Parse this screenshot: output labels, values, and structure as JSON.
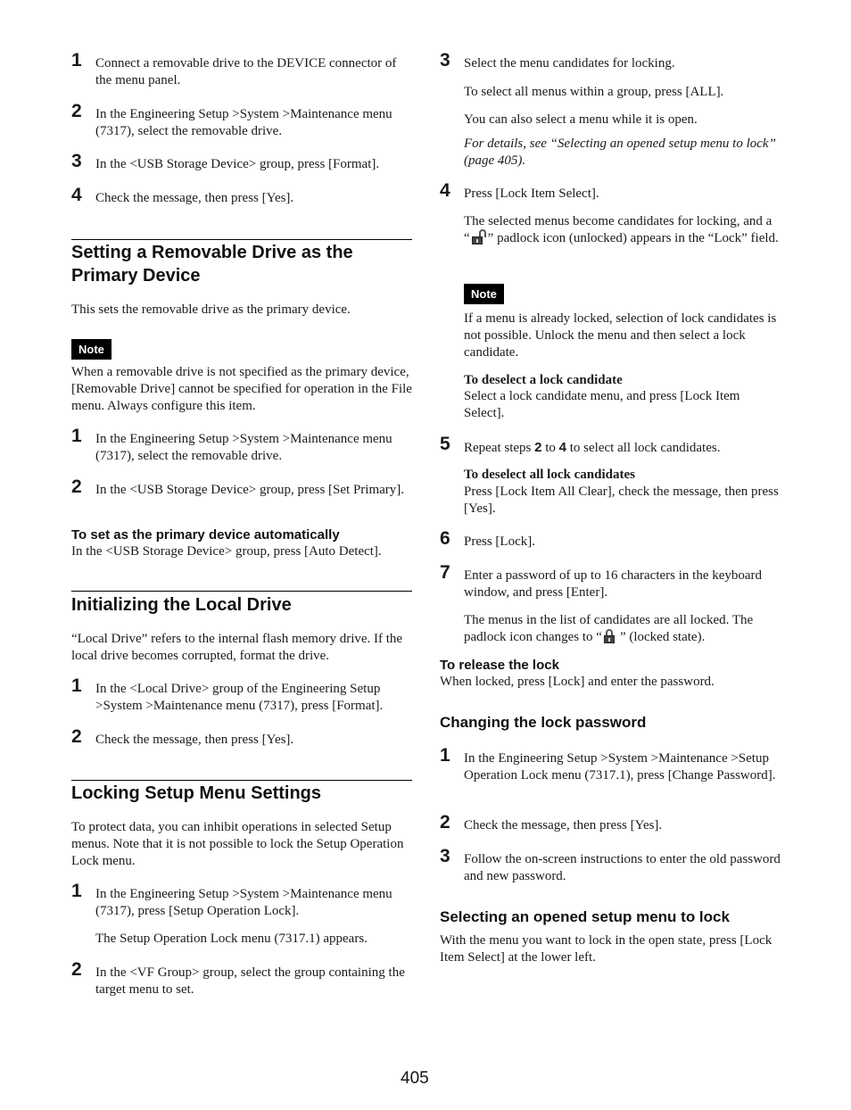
{
  "left": {
    "format_steps": [
      {
        "num": "1",
        "text": "Connect a removable drive to the DEVICE connector of the menu panel."
      },
      {
        "num": "2",
        "text": "In the Engineering Setup >System >Maintenance menu (7317), select the removable drive."
      },
      {
        "num": "3",
        "text": "In the <USB Storage Device> group, press [Format]."
      },
      {
        "num": "4",
        "text": "Check the message, then press [Yes]."
      }
    ],
    "primary": {
      "heading": "Setting a Removable Drive as the Primary Device",
      "intro": "This sets the removable drive as the primary device.",
      "note_label": "Note",
      "note_text": "When a removable drive is not specified as the primary device, [Removable Drive] cannot be specified for operation in the File menu. Always configure this item.",
      "steps": [
        {
          "num": "1",
          "text": "In the Engineering Setup >System >Maintenance menu (7317), select the removable drive."
        },
        {
          "num": "2",
          "text": "In the <USB Storage Device> group, press [Set Primary]."
        }
      ],
      "auto_heading": "To set as the primary device automatically",
      "auto_text": "In the <USB Storage Device> group, press [Auto Detect]."
    },
    "local": {
      "heading": "Initializing the Local Drive",
      "intro": "“Local Drive” refers to the internal flash memory drive. If the local drive becomes corrupted, format the drive.",
      "steps": [
        {
          "num": "1",
          "text": "In the <Local Drive> group of the Engineering Setup >System >Maintenance menu (7317), press [Format]."
        },
        {
          "num": "2",
          "text": "Check the message, then press [Yes]."
        }
      ]
    },
    "locking": {
      "heading": "Locking Setup Menu Settings",
      "intro": "To protect data, you can inhibit operations in selected Setup menus. Note that it is not possible to lock the Setup Operation Lock menu.",
      "steps": [
        {
          "num": "1",
          "text": "In the Engineering Setup >System >Maintenance menu (7317), press [Setup Operation Lock].",
          "sub": "The Setup Operation Lock menu (7317.1) appears."
        },
        {
          "num": "2",
          "text": "In the <VF Group> group, select the group containing the target menu to set."
        }
      ]
    }
  },
  "right": {
    "step3": {
      "num": "3",
      "text": "Select the menu candidates for locking.",
      "sub1": "To select all menus within a group, press [ALL].",
      "sub2": "You can also select a menu while it is open.",
      "ref": "For details, see “Selecting an opened setup menu to lock” (page 405)."
    },
    "step4": {
      "num": "4",
      "text": "Press [Lock Item Select].",
      "sub_a": "The selected menus become candidates for locking, and a “",
      "sub_b": "” padlock icon (unlocked) appears in the “Lock” field."
    },
    "note_label": "Note",
    "note_text": "If a menu is already locked, selection of lock candidates is not possible. Unlock the menu and then select a lock candidate.",
    "deselect_heading": "To deselect a lock candidate",
    "deselect_text": "Select a lock candidate menu, and press [Lock Item Select].",
    "step5": {
      "num": "5",
      "a": "Repeat steps ",
      "b": "2",
      "c": " to ",
      "d": "4",
      "e": " to select all lock candidates."
    },
    "deselect_all_heading": "To deselect all lock candidates",
    "deselect_all_text": "Press [Lock Item All Clear], check the message, then press [Yes].",
    "step6": {
      "num": "6",
      "text": "Press [Lock]."
    },
    "step7": {
      "num": "7",
      "text": "Enter a password of up to 16 characters in the keyboard window, and press [Enter].",
      "sub_a": "The menus in the list of candidates are all locked. The padlock icon changes to “",
      "sub_b": "” (locked state)."
    },
    "release_heading": "To release the lock",
    "release_text": "When locked, press [Lock] and enter the password.",
    "password": {
      "heading": "Changing the lock password",
      "steps": [
        {
          "num": "1",
          "text": "In the Engineering Setup >System >Maintenance >Setup Operation Lock menu (7317.1), press [Change Password]."
        },
        {
          "num": "2",
          "text": "Check the message, then press [Yes]."
        },
        {
          "num": "3",
          "text": "Follow the on-screen instructions to enter the old password and new password."
        }
      ]
    },
    "opened": {
      "heading": "Selecting an opened setup menu to lock",
      "text": "With the menu you want to lock in the open state, press [Lock Item Select] at the lower left."
    }
  },
  "page_number": "405"
}
